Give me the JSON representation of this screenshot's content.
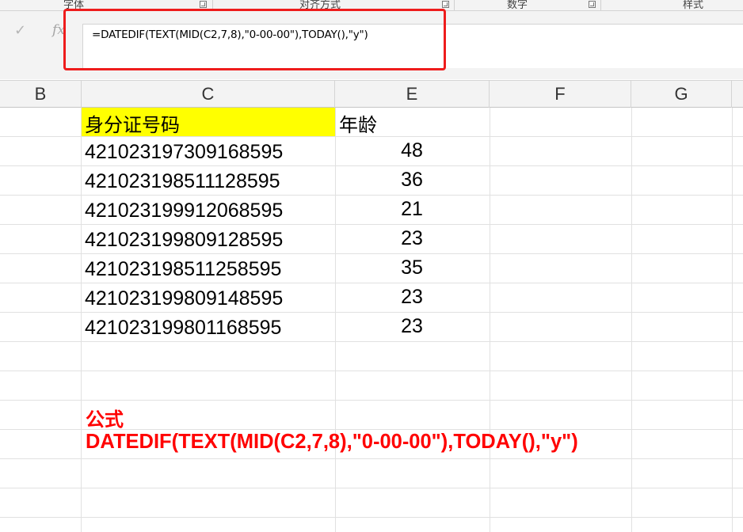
{
  "ribbon": {
    "groups": [
      {
        "label": "字体"
      },
      {
        "label": "对齐方式"
      },
      {
        "label": "数字"
      },
      {
        "label": "样式"
      }
    ]
  },
  "formula_bar": {
    "enter_icon": "check-icon",
    "fx_label": "fx",
    "content": "=DATEDIF(TEXT(MID(C2,7,8),\"0-00-00\"),TODAY(),\"y\")",
    "highlight_color": "#ee1c1c"
  },
  "columns": [
    "B",
    "C",
    "E",
    "F",
    "G"
  ],
  "sheet": {
    "header": {
      "id_label": "身分证号码",
      "age_label": "年龄",
      "highlight_color": "#ffff00"
    },
    "rows": [
      {
        "id": "421023197309168595",
        "age": "48"
      },
      {
        "id": "421023198511128595",
        "age": "36"
      },
      {
        "id": "421023199912068595",
        "age": "21"
      },
      {
        "id": "421023199809128595",
        "age": "23"
      },
      {
        "id": "421023198511258595",
        "age": "35"
      },
      {
        "id": "421023199809148595",
        "age": "23"
      },
      {
        "id": "421023199801168595",
        "age": "23"
      }
    ]
  },
  "note": {
    "title": "公式",
    "formula": "DATEDIF(TEXT(MID(C2,7,8),\"0-00-00\"),TODAY(),\"y\")",
    "color": "#ff0000"
  }
}
